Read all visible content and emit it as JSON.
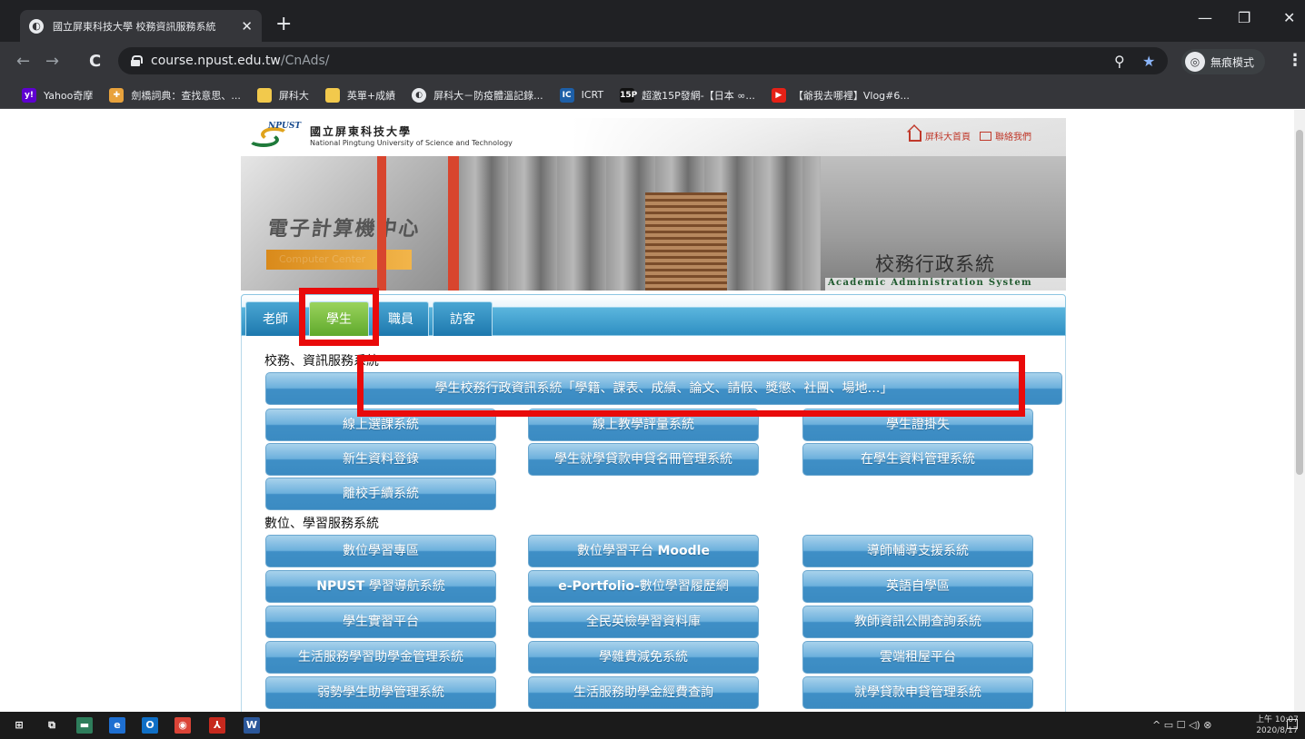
{
  "browser": {
    "tab_title": "國立屏東科技大學 校務資訊服務系統",
    "tab_close": "✕",
    "new_tab": "+",
    "url_host": "course.npust.edu.tw",
    "url_path": "/CnAds/",
    "incognito_label": "無痕模式",
    "back_icon": "←",
    "forward_icon": "→",
    "reload_icon": "C",
    "zoom_icon": "⚲",
    "star_icon": "★",
    "menu_icon": "⋮",
    "window_controls": {
      "minimize": "—",
      "restore": "❐",
      "close": "✕"
    }
  },
  "bookmarks": [
    {
      "label": "Yahoo奇摩",
      "icon": "yahoo-icon",
      "color": "#5f01d1",
      "glyph": "y!"
    },
    {
      "label": "劍橋詞典：查找意思、...",
      "icon": "cambridge-icon",
      "color": "#e8a23c",
      "glyph": "✚"
    },
    {
      "label": "屏科大",
      "icon": "folder-icon",
      "color": "#f2c94c",
      "glyph": ""
    },
    {
      "label": "英單+成績",
      "icon": "folder-icon",
      "color": "#f2c94c",
      "glyph": ""
    },
    {
      "label": "屏科大－防疫體溫記錄...",
      "icon": "globe-icon",
      "color": "#e8eaed",
      "glyph": "◐"
    },
    {
      "label": "ICRT",
      "icon": "icrt-icon",
      "color": "#1d5fa8",
      "glyph": "IC"
    },
    {
      "label": "超激15P發網-【日本 ∞...",
      "icon": "15p-icon",
      "color": "#111111",
      "glyph": "15P"
    },
    {
      "label": "【爺我去哪裡】Vlog#6...",
      "icon": "youtube-icon",
      "color": "#e62117",
      "glyph": "▶"
    }
  ],
  "header": {
    "logo_zh": "國立屏東科技大學",
    "logo_en": "National Pingtung University of Science and Technology",
    "logo_mark": "NPUST",
    "link_home": "屏科大首頁",
    "link_contact": "聯絡我們",
    "banner_title": "校務行政系統",
    "banner_subtitle": "Academic Administration System",
    "building_sign": "電子計算機中心",
    "building_sign_en": "Computer Center"
  },
  "nav": {
    "tabs": [
      {
        "label": "老師",
        "active": false
      },
      {
        "label": "學生",
        "active": true
      },
      {
        "label": "職員",
        "active": false
      },
      {
        "label": "訪客",
        "active": false
      }
    ]
  },
  "sections": {
    "admin_title": "校務、資訊服務系統",
    "learning_title": "數位、學習服務系統"
  },
  "admin_buttons": {
    "main": "學生校務行政資訊系統「學籍、課表、成績、論文、請假、獎懲、社團、場地…」",
    "b1": "線上選課系統",
    "b2": "線上教學評量系統",
    "b3": "學生證掛失",
    "b4": "新生資料登錄",
    "b5": "學生就學貸款申貸名冊管理系統",
    "b6": "在學生資料管理系統",
    "b7": "離校手續系統"
  },
  "learning_buttons": {
    "l1": "數位學習專區",
    "l2_prefix": "數位學習平台 ",
    "l2_bold": "Moodle",
    "l3": "導師輔導支援系統",
    "l4_bold": "NPUST",
    "l4_suffix": " 學習導航系統",
    "l5_bold": "e-Portfolio-",
    "l5_suffix": "數位學習履歷網",
    "l6": "英語自學區",
    "l7": "學生實習平台",
    "l8": "全民英檢學習資料庫",
    "l9": "教師資訊公開查詢系統",
    "l10": "生活服務學習助學金管理系統",
    "l11": "學雜費減免系統",
    "l12": "雲端租屋平台",
    "l13": "弱勢學生助學管理系統",
    "l14": "生活服務助學金經費查詢",
    "l15": "就學貸款申貸管理系統"
  },
  "taskbar": {
    "time": "上午 10:07",
    "date": "2020/8/17",
    "tray": "^ ▭ ☐ ◁) ⊗",
    "apps": [
      {
        "name": "windows-start-icon",
        "glyph": "⊞",
        "color": "#1b1b1b"
      },
      {
        "name": "task-view-icon",
        "glyph": "⧉",
        "color": "#1b1b1b"
      },
      {
        "name": "file-explorer-icon",
        "glyph": "▬",
        "color": "#2e7d5b"
      },
      {
        "name": "edge-icon",
        "glyph": "e",
        "color": "#1e6fd1"
      },
      {
        "name": "outlook-icon",
        "glyph": "O",
        "color": "#0f6fc6"
      },
      {
        "name": "chrome-icon",
        "glyph": "◉",
        "color": "#db4437"
      },
      {
        "name": "acrobat-icon",
        "glyph": "⅄",
        "color": "#c6291e"
      },
      {
        "name": "word-icon",
        "glyph": "W",
        "color": "#2b579a"
      }
    ]
  },
  "colors": {
    "highlight": "#e90a0a",
    "button_blue": "#3f8fc6",
    "active_tab_green": "#5fa92c",
    "nav_blue": "#2f8fc2"
  }
}
